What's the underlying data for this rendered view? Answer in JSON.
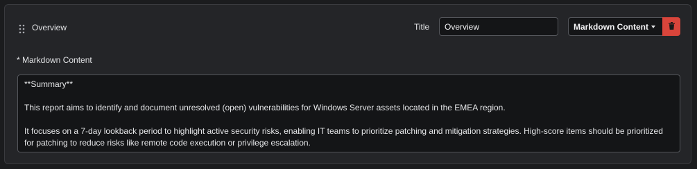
{
  "section": {
    "name": "Overview",
    "title_label": "Title",
    "title_value": "Overview",
    "content_type": "Markdown Content",
    "field_label": "* Markdown Content",
    "markdown_lines": [
      "**Summary**",
      "",
      "This report aims to identify and document unresolved (open) vulnerabilities for Windows Server assets located in the EMEA region.",
      "",
      "It focuses on a 7-day lookback period to highlight active security risks, enabling IT teams to prioritize patching and mitigation strategies. High-score items should be prioritized for patching to reduce risks like remote code execution or privilege escalation."
    ]
  },
  "icons": {
    "drag": "drag-handle-icon",
    "caret": "chevron-down-icon",
    "delete": "trash-icon"
  },
  "colors": {
    "delete_button": "#d9453b",
    "panel_background": "#242528",
    "input_background": "#141517"
  }
}
